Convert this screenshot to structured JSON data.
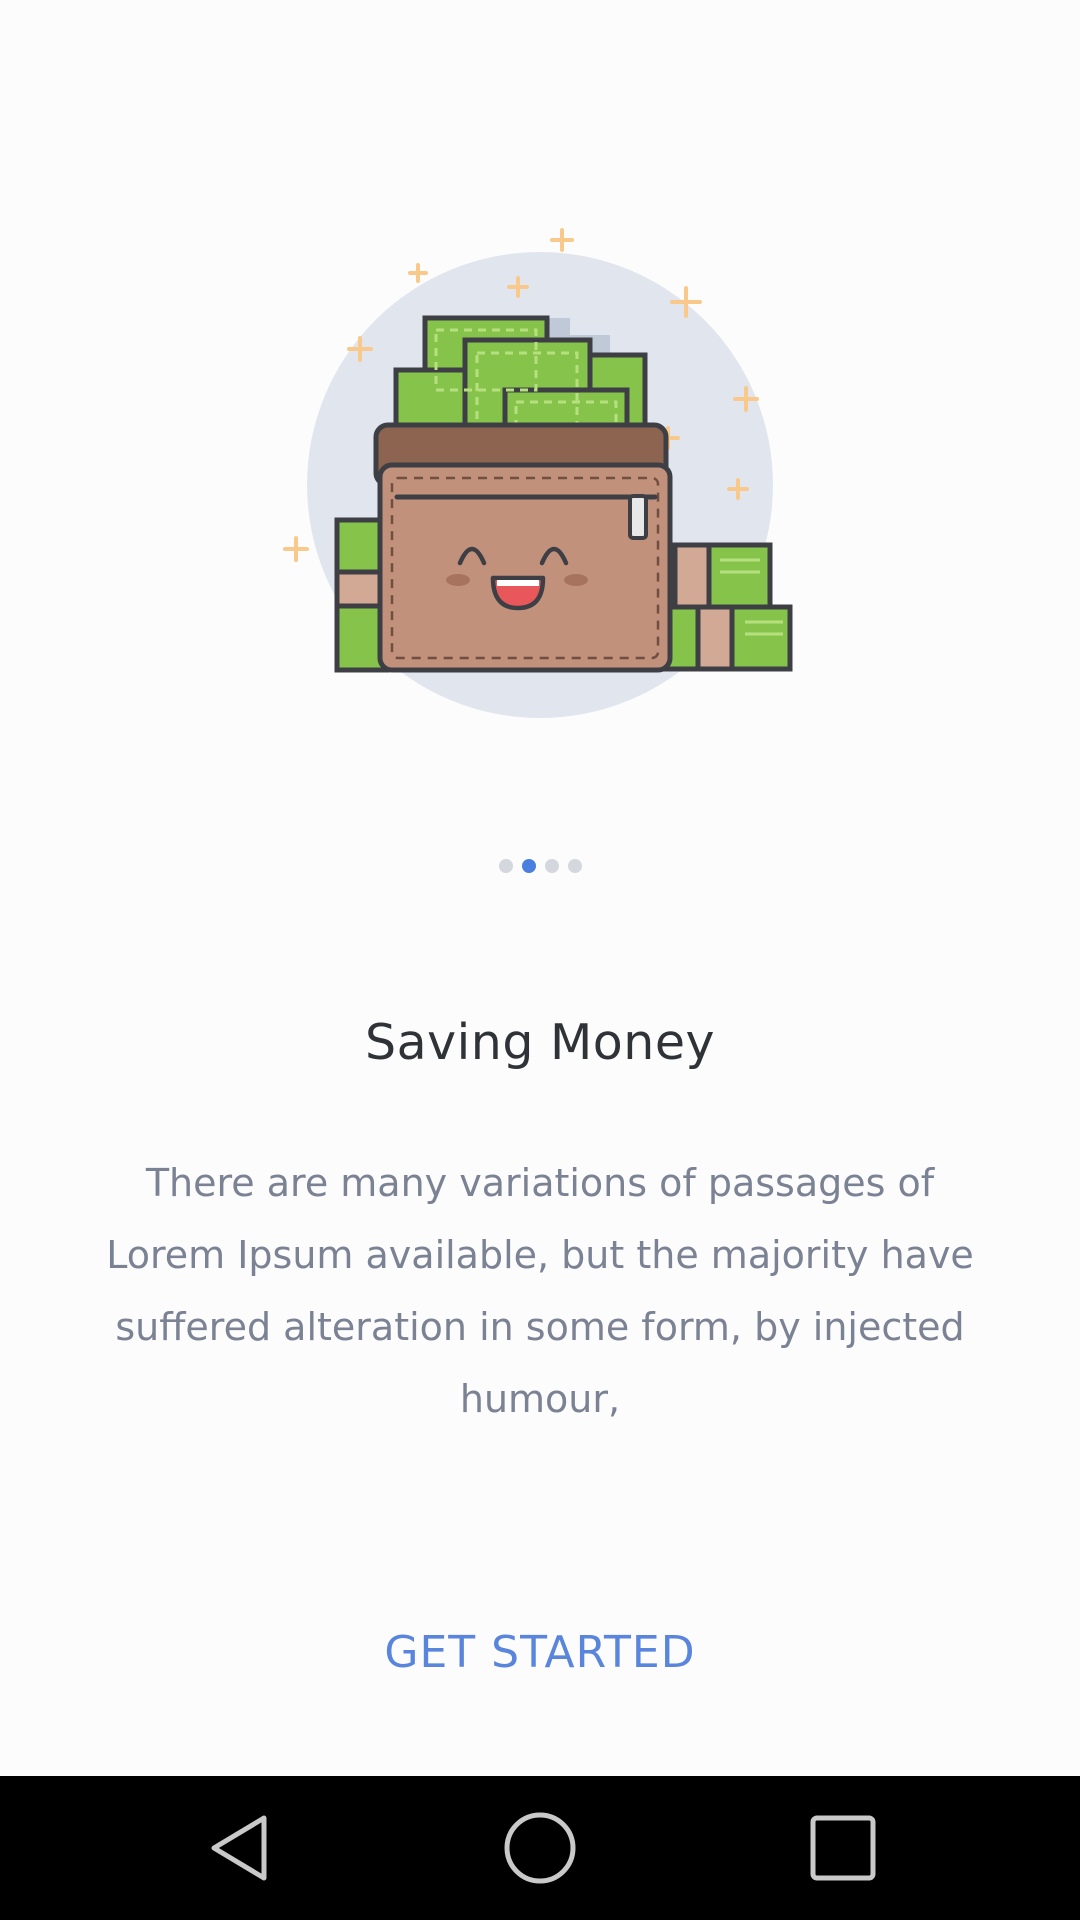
{
  "onboarding": {
    "title": "Saving Money",
    "description": "There are many variations of passages of Lorem Ipsum available, but the majority have suffered alteration in some form, by injected humour,",
    "cta_label": "GET STARTED",
    "page_indicator": {
      "total": 4,
      "current": 2
    }
  },
  "illustration": {
    "subject": "smiling-wallet-with-cash"
  },
  "system_nav": {
    "back_icon": "back-triangle-icon",
    "home_icon": "home-circle-icon",
    "recents_icon": "recents-square-icon"
  },
  "colors": {
    "background": "#fcfcfc",
    "accent": "#5a85dc",
    "title": "#2f3237",
    "body_text": "#7b8294",
    "dot_active": "#4a7fe0",
    "dot_inactive": "#d4d7dd",
    "nav_bar": "#000000"
  }
}
